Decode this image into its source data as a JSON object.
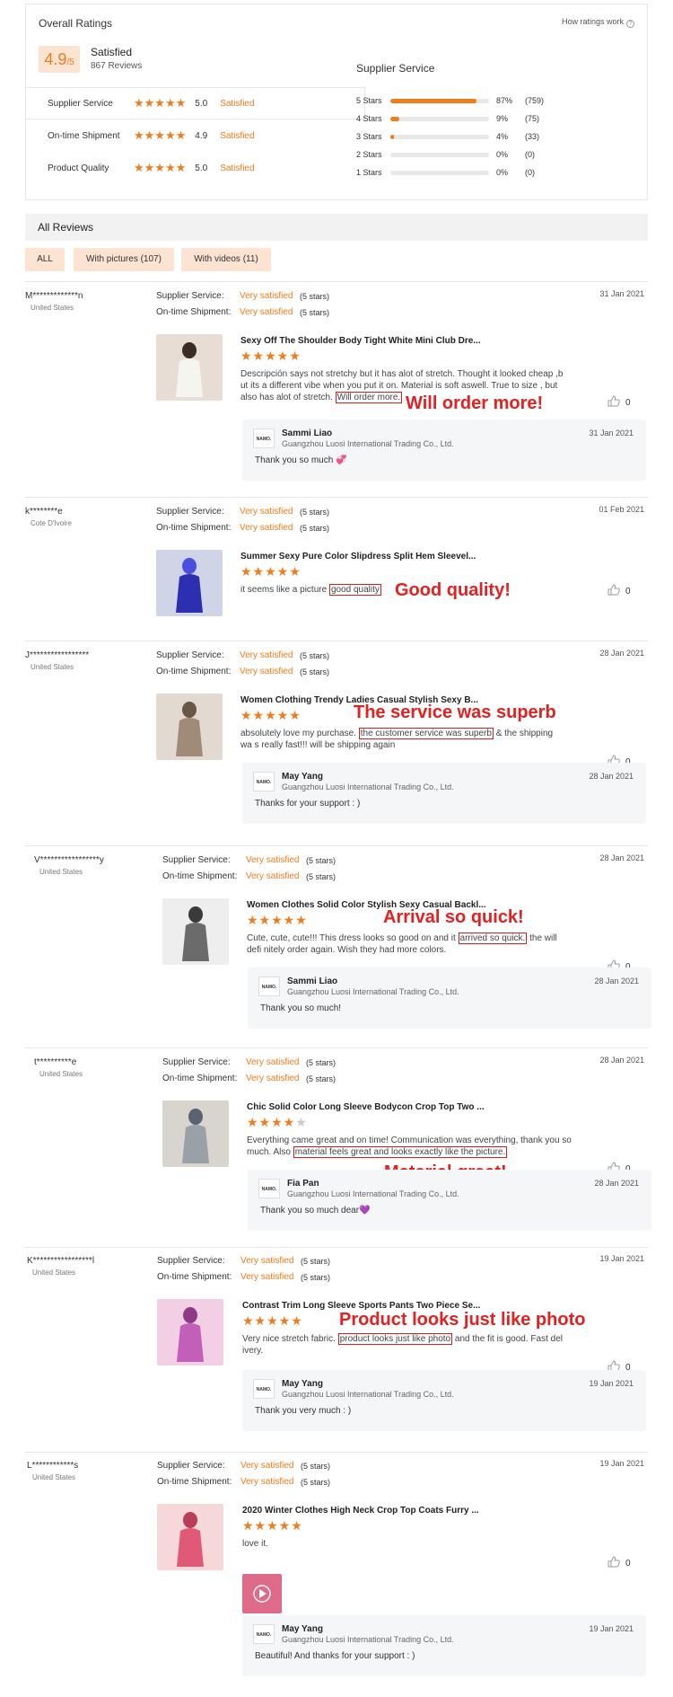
{
  "ratings": {
    "title": "Overall Ratings",
    "how_link": "How ratings work",
    "score": "4.9",
    "score_max": "/5",
    "summary": "Satisfied",
    "review_count": "867 Reviews",
    "categories": [
      {
        "label": "Supplier Service",
        "score": "5.0",
        "status": "Satisfied",
        "stars": 5
      },
      {
        "label": "On-time Shipment",
        "score": "4.9",
        "status": "Satisfied",
        "stars": 4.9
      },
      {
        "label": "Product Quality",
        "score": "5.0",
        "status": "Satisfied",
        "stars": 5
      }
    ],
    "breakdown_title": "Supplier Service",
    "breakdown": [
      {
        "label": "5 Stars",
        "pct": "87%",
        "count": "(759)",
        "fraction": 0.87
      },
      {
        "label": "4 Stars",
        "pct": "9%",
        "count": "(75)",
        "fraction": 0.09
      },
      {
        "label": "3 Stars",
        "pct": "4%",
        "count": "(33)",
        "fraction": 0.04
      },
      {
        "label": "2 Stars",
        "pct": "0%",
        "count": "(0)",
        "fraction": 0
      },
      {
        "label": "1 Stars",
        "pct": "0%",
        "count": "(0)",
        "fraction": 0
      }
    ]
  },
  "all_reviews": {
    "title": "All Reviews",
    "filters": [
      "ALL",
      "With pictures (107)",
      "With videos (11)"
    ]
  },
  "labels": {
    "supplier_service": "Supplier Service:",
    "ontime_shipment": "On-time Shipment:",
    "very_satisfied": "Very satisfied",
    "five_stars": "(5 stars)",
    "company": "Guangzhou Luosi International Trading Co., Ltd.",
    "logo_text": "NAMO."
  },
  "reviews": [
    {
      "user": "M*************n",
      "country": "United States",
      "date": "31 Jan 2021",
      "product": "Sexy Off The Shoulder Body Tight White Mini Club Dre...",
      "text_parts": [
        "Descripción says not stretchy but it has alot of stretch. Thought it looked cheap ,b ut its a different vibe when you put it on. Material is soft aswell. True to size , but also has alot of stretch.",
        "Will order more.",
        ""
      ],
      "annotation": "Will order more!",
      "likes": "0",
      "reply": {
        "name": "Sammi Liao",
        "date": "31 Jan 2021",
        "text": "Thank you so much 💞"
      }
    },
    {
      "user": "k********e",
      "country": "Cote D'Ivoire",
      "date": "01 Feb 2021",
      "product": "Summer Sexy Pure Color Slipdress Split Hem Sleevel...",
      "text_parts": [
        "it seems like a picture",
        "good quality",
        ""
      ],
      "annotation": "Good quality!",
      "likes": "0"
    },
    {
      "user": "J*****************",
      "country": "United States",
      "date": "28 Jan 2021",
      "product": "Women Clothing Trendy Ladies Casual Stylish Sexy B...",
      "text_parts": [
        "absolutely love my purchase.",
        "the customer service was superb",
        "& the shipping wa s really fast!!! will be shipping again"
      ],
      "annotation": "The service was superb",
      "likes": "0",
      "reply": {
        "name": "May Yang",
        "date": "28 Jan 2021",
        "text": "Thanks for your support : )"
      }
    },
    {
      "user": "V*****************y",
      "country": "United States",
      "date": "28 Jan 2021",
      "product": "Women Clothes Solid Color Stylish Sexy Casual Backl...",
      "text_parts": [
        "Cute, cute, cute!!! This dress looks so good on and it",
        "arrived so quick.",
        "the will defi nitely order again. Wish they had more colors."
      ],
      "annotation": "Arrival so quick!",
      "likes": "0",
      "reply": {
        "name": "Sammi Liao",
        "date": "28 Jan 2021",
        "text": "Thank you so much!"
      }
    },
    {
      "user": "t**********e",
      "country": "United States",
      "date": "28 Jan 2021",
      "product": "Chic Solid Color Long Sleeve Bodycon Crop Top Two ...",
      "stars": 4,
      "text_parts": [
        "Everything came great and on time! Communication was everything, thank you so much. Also",
        "material feels great and looks exactly like the picture.",
        ""
      ],
      "annotation": "Material great!",
      "likes": "0",
      "reply": {
        "name": "Fia Pan",
        "date": "28 Jan 2021",
        "text": "Thank you so much dear💜"
      }
    },
    {
      "user": "K*****************l",
      "country": "United States",
      "date": "19 Jan 2021",
      "product": "Contrast Trim Long Sleeve Sports Pants Two Piece Se...",
      "text_parts": [
        "Very nice stretch fabric.",
        "product looks just like photo",
        "and the fit is good.  Fast del ivery."
      ],
      "annotation": "Product looks just like photo",
      "likes": "0",
      "reply": {
        "name": "May Yang",
        "date": "19 Jan 2021",
        "text": "Thank you very much : )"
      }
    },
    {
      "user": "L************s",
      "country": "United States",
      "date": "19 Jan 2021",
      "product": "2020 Winter Clothes High Neck Crop Top Coats Furry ...",
      "text_parts": [
        "love it.",
        "",
        ""
      ],
      "annotation": "",
      "likes": "0",
      "reply": {
        "name": "May Yang",
        "date": "19 Jan 2021",
        "text": "Beautiful! And thanks for your support : )"
      }
    }
  ],
  "colors": {
    "accent": "#f07c1c",
    "accent_bg": "#fde3d2",
    "annotation_red": "#e52020"
  }
}
